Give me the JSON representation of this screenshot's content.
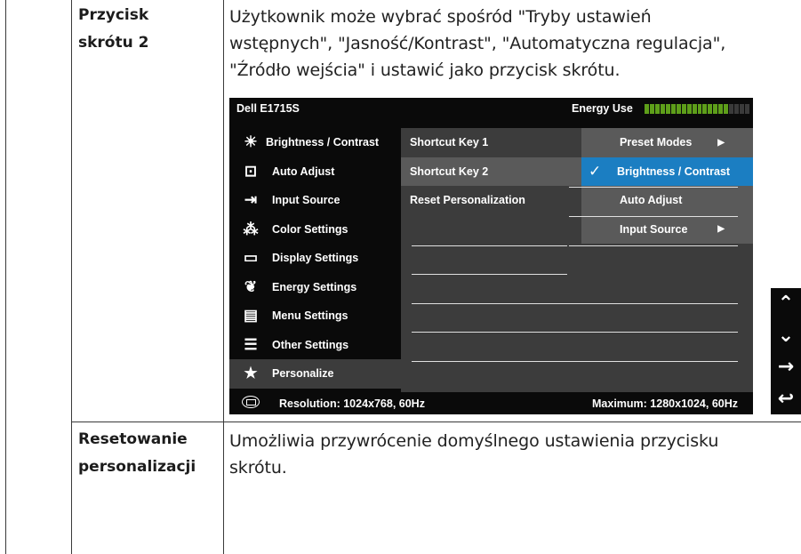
{
  "row1": {
    "term_line1": "Przycisk",
    "term_line2": "skrótu 2",
    "desc_line1": "Użytkownik może wybrać spośród \"Tryby ustawień",
    "desc_line2": "wstępnych\", \"Jasność/Kontrast\", \"Automatyczna regulacja\",",
    "desc_line3": "\"Źródło wejścia\" i ustawić jako przycisk skrótu."
  },
  "row2": {
    "term_line1": "Resetowanie",
    "term_line2": "personalizacji",
    "desc_line1": "Umożliwia przywrócenie domyślnego ustawienia przycisku",
    "desc_line2": "skrótu."
  },
  "osd": {
    "title": "Dell E1715S",
    "energy_label": "Energy Use",
    "energy_level": 0.8,
    "menu": [
      {
        "icon": "brightness-icon",
        "glyph": "☀",
        "label": "Brightness / Contrast"
      },
      {
        "icon": "auto-adjust-icon",
        "glyph": "⊡",
        "label": "Auto Adjust"
      },
      {
        "icon": "input-source-icon",
        "glyph": "⇥",
        "label": "Input Source"
      },
      {
        "icon": "color-settings-icon",
        "glyph": "⁂",
        "label": "Color Settings"
      },
      {
        "icon": "display-settings-icon",
        "glyph": "▭",
        "label": "Display Settings"
      },
      {
        "icon": "energy-settings-icon",
        "glyph": "❦",
        "label": "Energy Settings"
      },
      {
        "icon": "menu-settings-icon",
        "glyph": "▤",
        "label": "Menu Settings"
      },
      {
        "icon": "other-settings-icon",
        "glyph": "☰",
        "label": "Other Settings"
      },
      {
        "icon": "personalize-icon",
        "glyph": "★",
        "label": "Personalize"
      }
    ],
    "submenu": [
      "Shortcut Key 1",
      "Shortcut Key 2",
      "Reset Personalization"
    ],
    "options": [
      {
        "label": "Preset Modes",
        "arrow": "▶"
      },
      {
        "label": "Brightness / Contrast",
        "check": "✓"
      },
      {
        "label": "Auto Adjust"
      },
      {
        "label": "Input Source",
        "arrow": "▶"
      }
    ],
    "resolution": "Resolution: 1024x768, 60Hz",
    "maximum": "Maximum: 1280x1024, 60Hz"
  },
  "side_buttons": [
    {
      "name": "up-icon",
      "glyph": "⌃"
    },
    {
      "name": "down-icon",
      "glyph": "⌄"
    },
    {
      "name": "right-arrow-icon",
      "glyph": "→"
    },
    {
      "name": "back-icon",
      "glyph": "↩"
    }
  ],
  "colors": {
    "highlight": "#1b7ec2",
    "energy_on": "#5e9f1a"
  }
}
